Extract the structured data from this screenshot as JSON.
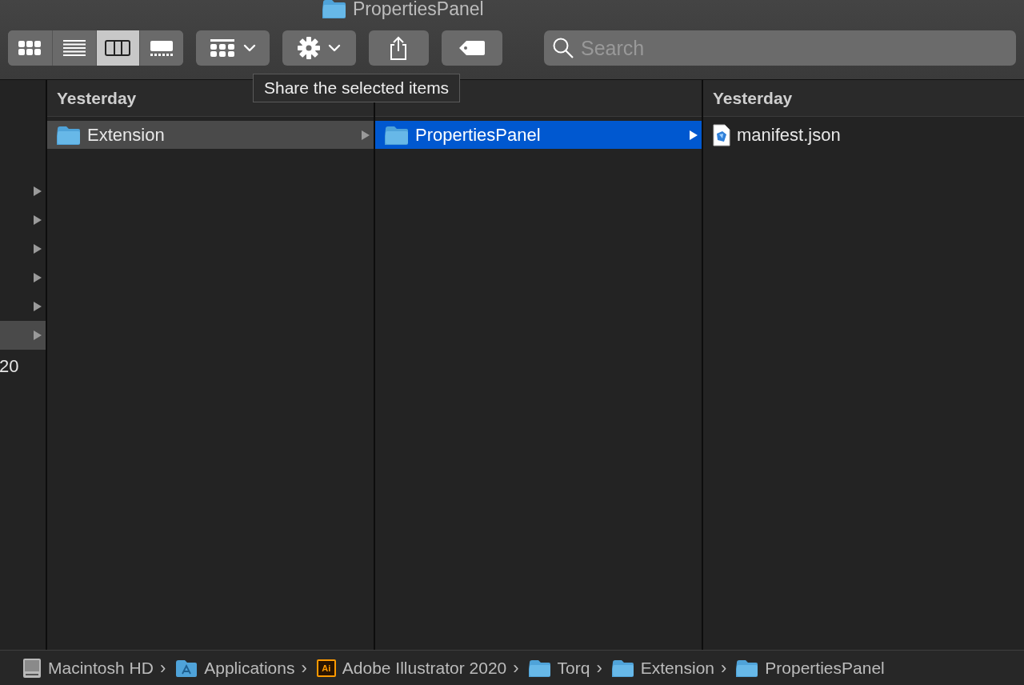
{
  "window": {
    "title": "PropertiesPanel"
  },
  "toolbar": {
    "view_modes": [
      {
        "kind": "icons",
        "selected": false
      },
      {
        "kind": "list",
        "selected": false
      },
      {
        "kind": "columns",
        "selected": true
      },
      {
        "kind": "gallery",
        "selected": false
      }
    ],
    "buttons": [
      {
        "kind": "group"
      },
      {
        "kind": "action"
      },
      {
        "kind": "share"
      },
      {
        "kind": "tag"
      }
    ],
    "search": {
      "placeholder": "Search"
    }
  },
  "tooltip": "Share the selected items",
  "partial_column": {
    "rows": [
      {
        "selected": false
      },
      {
        "selected": false
      },
      {
        "selected": false
      },
      {
        "selected": false
      },
      {
        "selected": false
      },
      {
        "selected": true
      }
    ],
    "text": "20"
  },
  "columns": [
    {
      "header": "Yesterday",
      "items": [
        {
          "name": "Extension",
          "kind": "folder",
          "selected": true,
          "focused": false,
          "has_children": true
        }
      ]
    },
    {
      "items": [
        {
          "name": "PropertiesPanel",
          "kind": "folder",
          "selected": true,
          "focused": true,
          "has_children": true
        }
      ]
    },
    {
      "header": "Yesterday",
      "items": [
        {
          "name": "manifest.json",
          "kind": "file",
          "selected": false,
          "focused": false,
          "has_children": false
        }
      ]
    }
  ],
  "path_bar": [
    {
      "label": "Macintosh HD",
      "kind": "disk",
      "separator": "›"
    },
    {
      "label": "Applications",
      "kind": "apps",
      "separator": "›"
    },
    {
      "label": "Adobe Illustrator 2020",
      "kind": "app",
      "badge": "Ai",
      "separator": "›"
    },
    {
      "label": "Torq",
      "kind": "folder",
      "separator": "›"
    },
    {
      "label": "Extension",
      "kind": "folder",
      "separator": "›"
    },
    {
      "label": "PropertiesPanel",
      "kind": "folder"
    }
  ]
}
